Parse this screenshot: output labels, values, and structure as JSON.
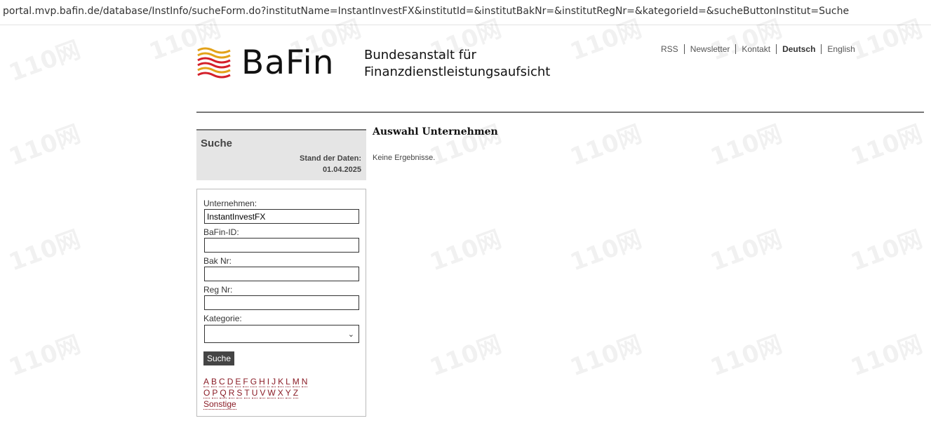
{
  "browser": {
    "url": "portal.mvp.bafin.de/database/InstInfo/sucheForm.do?institutName=InstantInvestFX&institutId=&institutBakNr=&institutRegNr=&kategorieId=&sucheButtonInstitut=Suche"
  },
  "header": {
    "brand": "BaFin",
    "agency_line1": "Bundesanstalt für",
    "agency_line2": "Finanzdienstleistungsaufsicht",
    "nav": [
      "RSS",
      "Newsletter",
      "Kontakt",
      "Deutsch",
      "English"
    ],
    "active_nav": "Deutsch"
  },
  "sidebar": {
    "title": "Suche",
    "stand_label": "Stand der Daten:",
    "stand_date": "01.04.2025",
    "fields": {
      "unternehmen_label": "Unternehmen:",
      "unternehmen_value": "InstantInvestFX",
      "bafin_id_label": "BaFin-ID:",
      "bafin_id_value": "",
      "bak_nr_label": "Bak Nr:",
      "bak_nr_value": "",
      "reg_nr_label": "Reg Nr:",
      "reg_nr_value": "",
      "kategorie_label": "Kategorie:",
      "kategorie_value": ""
    },
    "submit_label": "Suche",
    "alphabet_row1": [
      "A",
      "B",
      "C",
      "D",
      "E",
      "F",
      "G",
      "H",
      "I",
      "J",
      "K",
      "L",
      "M",
      "N"
    ],
    "alphabet_row2": [
      "O",
      "P",
      "Q",
      "R",
      "S",
      "T",
      "U",
      "V",
      "W",
      "X",
      "Y",
      "Z"
    ],
    "other_label": "Sonstige"
  },
  "main": {
    "title": "Auswahl Unternehmen",
    "result_text": "Keine Ergebnisse."
  },
  "watermark": {
    "text": "110网"
  },
  "colors": {
    "link": "#8a1c26",
    "button": "#444444",
    "panel": "#e5e5e5"
  }
}
